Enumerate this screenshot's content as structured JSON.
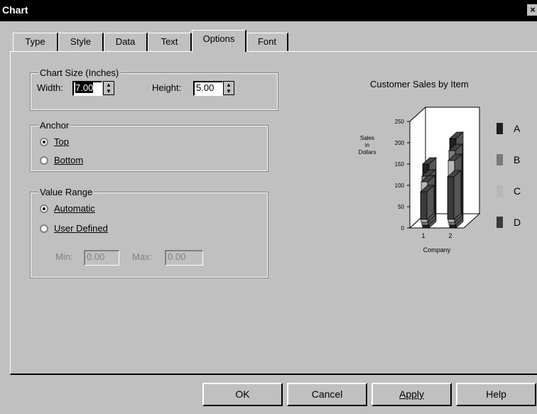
{
  "window": {
    "title": "Chart",
    "close": "×"
  },
  "tabs": [
    "Type",
    "Style",
    "Data",
    "Text",
    "Options",
    "Font"
  ],
  "chart_size": {
    "group": "Chart Size (Inches)",
    "width_label": "Width:",
    "width_value": "7.00",
    "height_label": "Height:",
    "height_value": "5.00"
  },
  "anchor": {
    "group": "Anchor",
    "options": [
      "Top",
      "Bottom"
    ],
    "selected": "Top"
  },
  "value_range": {
    "group": "Value Range",
    "options": [
      "Automatic",
      "User Defined"
    ],
    "selected": "Automatic",
    "min_label": "Min:",
    "min_value": "0.00",
    "max_label": "Max:",
    "max_value": "0.00"
  },
  "preview": {
    "title": "Customer Sales by Item",
    "ylabel_lines": [
      "Sales",
      "in",
      "Dollars"
    ],
    "xlabel": "Company",
    "yticks": [
      "250",
      "200",
      "150",
      "100",
      "50",
      "0"
    ],
    "xticks": [
      "1",
      "2"
    ],
    "legend": [
      {
        "label": "A",
        "color": "#202020"
      },
      {
        "label": "B",
        "color": "#7a7a7a"
      },
      {
        "label": "C",
        "color": "#b8b8b8"
      },
      {
        "label": "D",
        "color": "#3a3a3a"
      }
    ]
  },
  "buttons": {
    "ok": "OK",
    "cancel": "Cancel",
    "apply": "Apply",
    "help": "Help"
  },
  "chart_data": {
    "type": "bar",
    "title": "Customer Sales by Item",
    "xlabel": "Company",
    "ylabel": "Sales in Dollars",
    "categories": [
      "1",
      "2"
    ],
    "ylim": [
      0,
      250
    ],
    "series": [
      {
        "name": "A",
        "values": [
          150,
          210
        ]
      },
      {
        "name": "B",
        "values": [
          115,
          175
        ]
      },
      {
        "name": "C",
        "values": [
          95,
          145
        ]
      },
      {
        "name": "D",
        "values": [
          65,
          100
        ]
      }
    ]
  }
}
